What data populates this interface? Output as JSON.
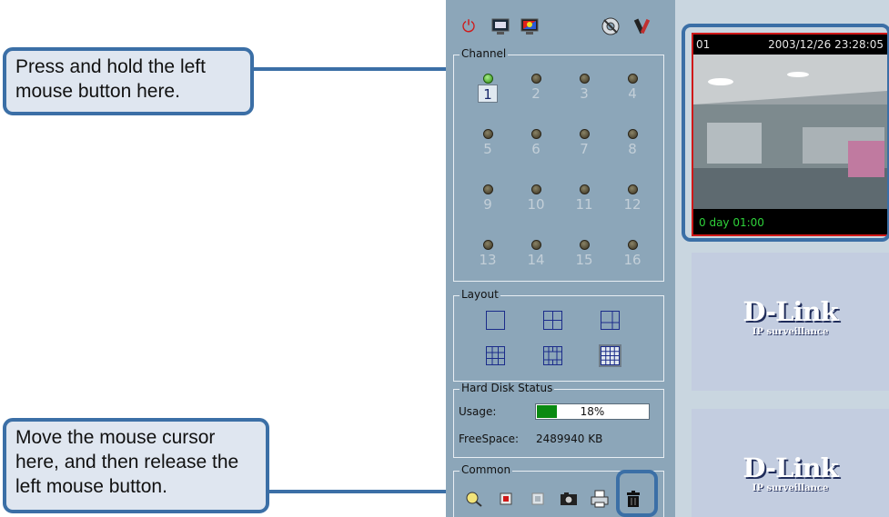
{
  "callouts": {
    "top": "Press and hold the left mouse button here.",
    "bottom": "Move the mouse cursor here, and then release the left mouse button."
  },
  "toolbar": {
    "icons": [
      "power-icon",
      "monitor-icon",
      "color-monitor-icon",
      "settings-disc-icon",
      "tools-icon"
    ]
  },
  "channel": {
    "title": "Channel",
    "items": [
      {
        "label": "1",
        "active": true,
        "selected": true
      },
      {
        "label": "2"
      },
      {
        "label": "3"
      },
      {
        "label": "4"
      },
      {
        "label": "5"
      },
      {
        "label": "6"
      },
      {
        "label": "7"
      },
      {
        "label": "8"
      },
      {
        "label": "9"
      },
      {
        "label": "10"
      },
      {
        "label": "11"
      },
      {
        "label": "12"
      },
      {
        "label": "13"
      },
      {
        "label": "14"
      },
      {
        "label": "15"
      },
      {
        "label": "16"
      }
    ]
  },
  "layout": {
    "title": "Layout",
    "options": [
      "1x1",
      "2x2",
      "1+3",
      "3x3",
      "1+12",
      "4x4"
    ],
    "selected": "4x4"
  },
  "hdd": {
    "title": "Hard Disk Status",
    "usage_label": "Usage:",
    "usage_percent": 18,
    "usage_text": "18%",
    "freespace_label": "FreeSpace:",
    "freespace_value": "2489940 KB"
  },
  "common": {
    "title": "Common",
    "icons": [
      "search-icon",
      "record-icon",
      "stop-icon",
      "snapshot-icon",
      "print-icon",
      "trash-icon"
    ]
  },
  "camera1": {
    "id": "01",
    "timestamp": "2003/12/26 23:28:05",
    "record_time": "0 day  01:00"
  },
  "dlink": {
    "logo": "D-Link",
    "sub": "IP surveillance"
  },
  "colors": {
    "accent": "#3b6fa6",
    "panel": "#8ca6b9",
    "active_frame": "#d01818"
  }
}
